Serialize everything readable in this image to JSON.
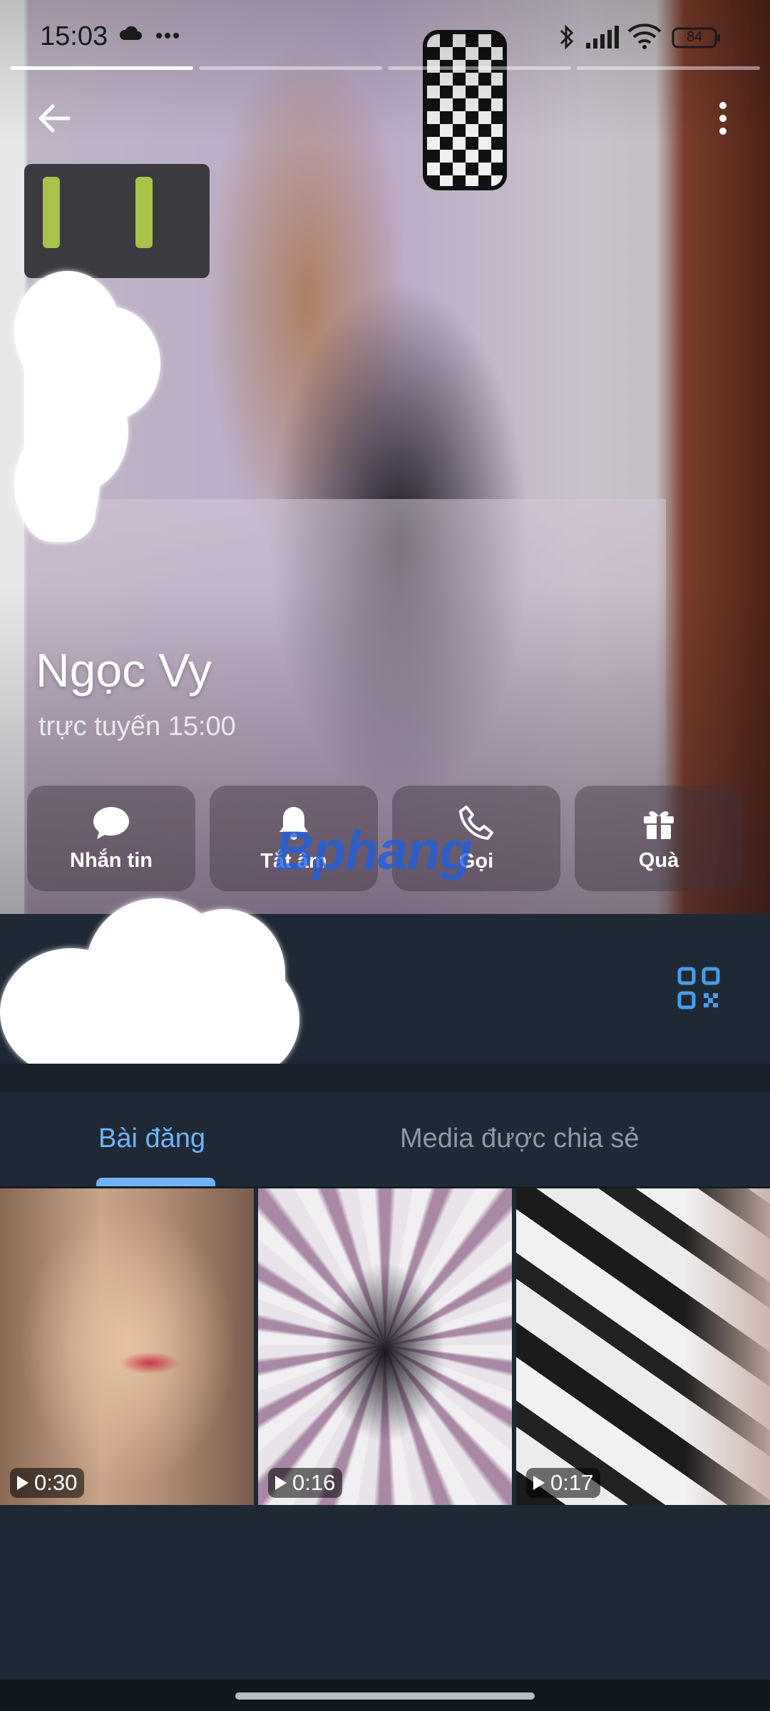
{
  "status_bar": {
    "time": "15:03",
    "battery": "84",
    "icons": [
      "cloud-icon",
      "more-dots-icon",
      "bluetooth-icon",
      "signal-icon",
      "wifi-icon",
      "battery-icon"
    ]
  },
  "story_progress": {
    "segments": 4,
    "active_index": 0
  },
  "profile": {
    "name": "Ngọc Vy",
    "last_seen": "trực tuyến 15:00"
  },
  "actions": [
    {
      "label": "Nhắn tin",
      "icon": "message-bubble-icon"
    },
    {
      "label": "Tắt âm",
      "icon": "bell-icon"
    },
    {
      "label": "Gọi",
      "icon": "phone-icon"
    },
    {
      "label": "Quà",
      "icon": "gift-icon"
    }
  ],
  "watermark": "Bphang",
  "tabs": [
    {
      "label": "Bài đăng",
      "active": true
    },
    {
      "label": "Media được chia sẻ",
      "active": false
    }
  ],
  "media": [
    {
      "duration": "0:30"
    },
    {
      "duration": "0:16"
    },
    {
      "duration": "0:17"
    }
  ],
  "colors": {
    "accent": "#6fb3f5",
    "background": "#1e2733",
    "panel": "#1f2936"
  }
}
